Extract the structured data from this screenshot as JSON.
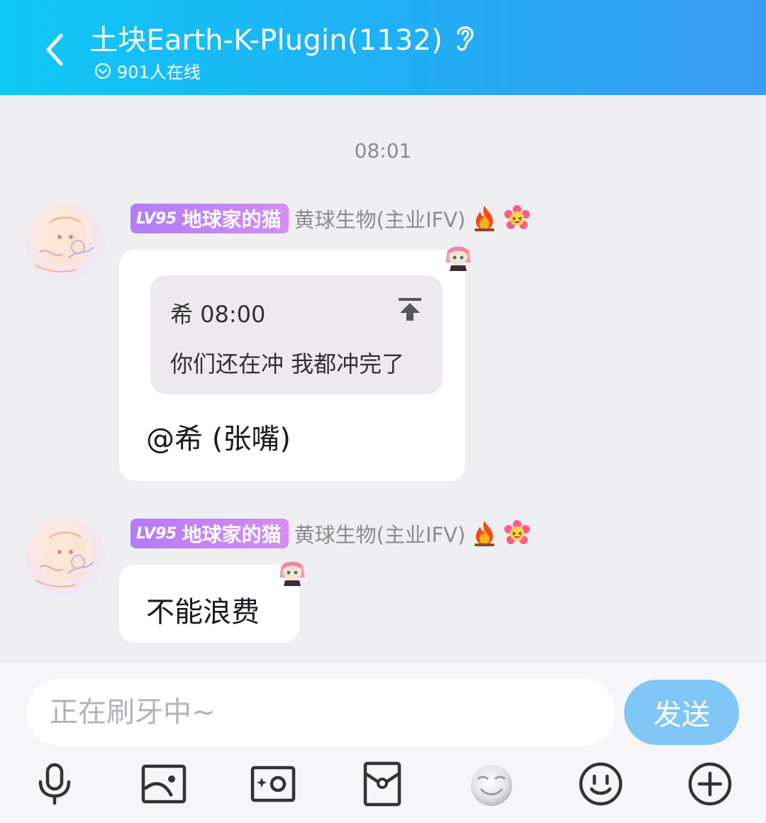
{
  "header": {
    "title": "土块Earth-K-Plugin(1132)",
    "online": "901人在线"
  },
  "chat": {
    "time_divider": "08:01",
    "messages": [
      {
        "level": "LV95",
        "level_title": "地球家的猫",
        "nickname": "黄球生物(主业IFV)",
        "quote": {
          "author_time": "希 08:00",
          "text": "你们还在冲 我都冲完了"
        },
        "text": "@希 (张嘴)"
      },
      {
        "level": "LV95",
        "level_title": "地球家的猫",
        "nickname": "黄球生物(主业IFV)",
        "text": "不能浪费"
      }
    ]
  },
  "input": {
    "placeholder": "正在刷牙中~",
    "send_label": "发送"
  },
  "toolbar": {
    "icons": [
      "microphone-icon",
      "image-icon",
      "camera-icon",
      "red-packet-icon",
      "interactive-emoji-icon",
      "emoji-icon",
      "plus-icon"
    ]
  },
  "colors": {
    "header_start": "#10c8f5",
    "header_end": "#3a9cf3",
    "level_badge": "#b27cf6",
    "send_button": "#80c6f6"
  }
}
